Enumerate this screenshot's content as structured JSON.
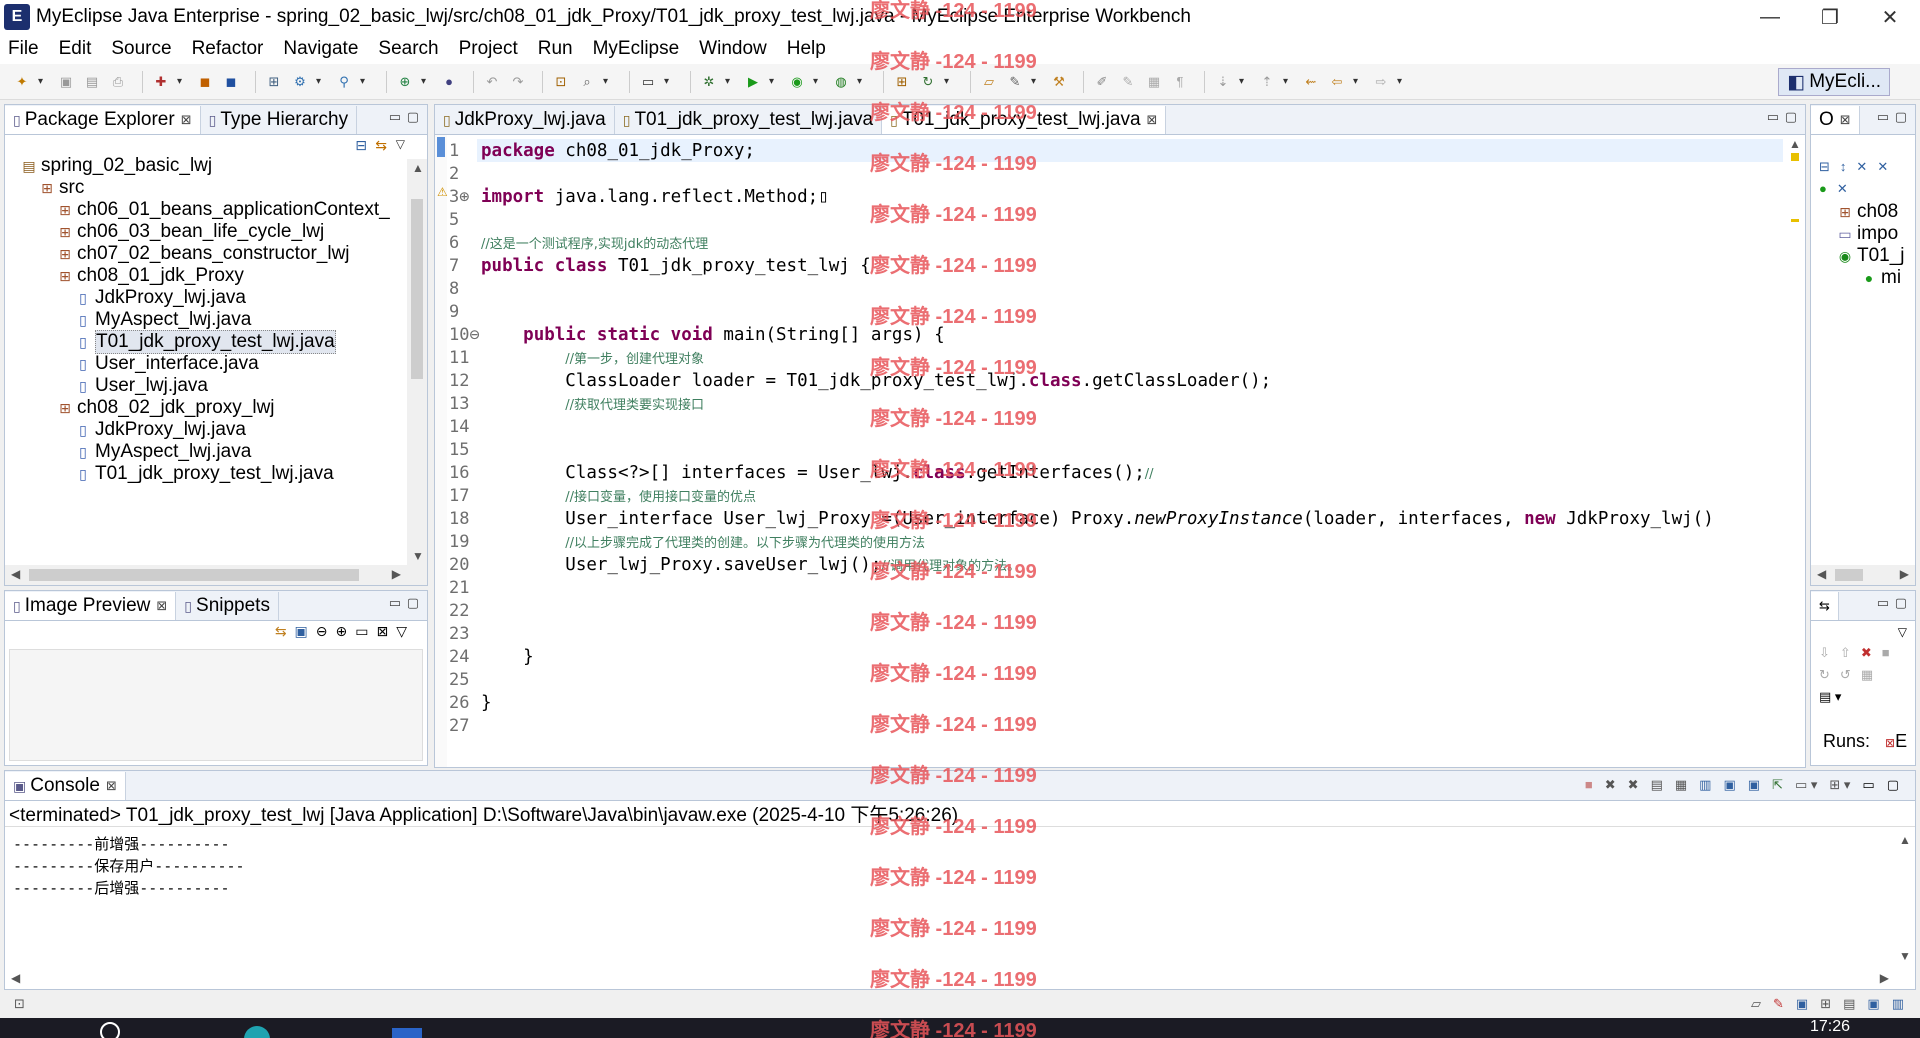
{
  "window": {
    "app_icon": "eclipse-icon",
    "title": "MyEclipse Java Enterprise - spring_02_basic_lwj/src/ch08_01_jdk_Proxy/T01_jdk_proxy_test_lwj.java - MyEclipse Enterprise Workbench",
    "minimize": "—",
    "maximize": "❐",
    "close": "✕"
  },
  "menu": [
    "File",
    "Edit",
    "Source",
    "Refactor",
    "Navigate",
    "Search",
    "Project",
    "Run",
    "MyEclipse",
    "Window",
    "Help"
  ],
  "toolbar": {
    "perspective_label": "MyEcli...",
    "perspective_icon": "myeclipse-perspective-icon",
    "open_perspective_icon": "open-perspective-icon"
  },
  "package_explorer": {
    "tabs": [
      {
        "label": "Package Explorer",
        "close": "⊠",
        "icon": "package-explorer-icon"
      },
      {
        "label": "Type Hierarchy",
        "icon": "type-hierarchy-icon"
      }
    ],
    "tree": [
      {
        "label": "spring_02_basic_lwj",
        "indent": 0,
        "kind": "project"
      },
      {
        "label": "src",
        "indent": 1,
        "kind": "folder"
      },
      {
        "label": "ch06_01_beans_applicationContext_",
        "indent": 2,
        "kind": "package"
      },
      {
        "label": "ch06_03_bean_life_cycle_lwj",
        "indent": 2,
        "kind": "package"
      },
      {
        "label": "ch07_02_beans_constructor_lwj",
        "indent": 2,
        "kind": "package"
      },
      {
        "label": "ch08_01_jdk_Proxy",
        "indent": 2,
        "kind": "package"
      },
      {
        "label": "JdkProxy_lwj.java",
        "indent": 3,
        "kind": "java"
      },
      {
        "label": "MyAspect_lwj.java",
        "indent": 3,
        "kind": "java"
      },
      {
        "label": "T01_jdk_proxy_test_lwj.java",
        "indent": 3,
        "kind": "java",
        "selected": true
      },
      {
        "label": "User_interface.java",
        "indent": 3,
        "kind": "java"
      },
      {
        "label": "User_lwj.java",
        "indent": 3,
        "kind": "java"
      },
      {
        "label": "ch08_02_jdk_proxy_lwj",
        "indent": 2,
        "kind": "package"
      },
      {
        "label": "JdkProxy_lwj.java",
        "indent": 3,
        "kind": "java"
      },
      {
        "label": "MyAspect_lwj.java",
        "indent": 3,
        "kind": "java"
      },
      {
        "label": "T01_jdk_proxy_test_lwj.java",
        "indent": 3,
        "kind": "java"
      }
    ]
  },
  "image_preview": {
    "tabs": [
      {
        "label": "Image Preview",
        "close": "⊠",
        "icon": "image-preview-icon"
      },
      {
        "label": "Snippets",
        "icon": "snippets-icon"
      }
    ]
  },
  "editor": {
    "tabs": [
      {
        "label": "JdkProxy_lwj.java",
        "icon": "java-file-icon"
      },
      {
        "label": "T01_jdk_proxy_test_lwj.java",
        "icon": "java-file-icon"
      },
      {
        "label": "T01_jdk_proxy_test_lwj.java",
        "close": "⊠",
        "active": true,
        "icon": "java-file-icon"
      }
    ],
    "lines": [
      {
        "n": "1",
        "html": "<span class=\"kw\">package</span> ch08_01_jdk_Proxy;"
      },
      {
        "n": "2",
        "html": ""
      },
      {
        "n": "3⊕",
        "html": "<span class=\"kw\">import</span> java.lang.reflect.Method;▯"
      },
      {
        "n": "5",
        "html": ""
      },
      {
        "n": "6",
        "html": "<span class=\"cm\">//这是一个测试程序,实现jdk的动态代理</span>"
      },
      {
        "n": "7",
        "html": "<span class=\"kw\">public class</span> T01_jdk_proxy_test_lwj {"
      },
      {
        "n": "8",
        "html": ""
      },
      {
        "n": "9",
        "html": ""
      },
      {
        "n": "10⊖",
        "html": "    <span class=\"kw\">public static void</span> main(String[] args) {"
      },
      {
        "n": "11",
        "html": "        <span class=\"cm\">//第一步，创建代理对象</span>"
      },
      {
        "n": "12",
        "html": "        ClassLoader loader = T01_jdk_proxy_test_lwj.<span class=\"kw\">class</span>.getClassLoader();"
      },
      {
        "n": "13",
        "html": "        <span class=\"cm\">//获取代理类要实现接口</span>"
      },
      {
        "n": "14",
        "html": ""
      },
      {
        "n": "15",
        "html": ""
      },
      {
        "n": "16",
        "html": "        Class&lt;?&gt;[] interfaces = User_lwj.<span class=\"kw\">class</span>.getInterfaces();<span class=\"cm\">//</span>"
      },
      {
        "n": "17",
        "html": "        <span class=\"cm\">//接口变量，使用接口变量的优点</span>"
      },
      {
        "n": "18",
        "html": "        User_interface User_lwj_Proxy =(User_interface) Proxy.<span class=\"it\">newProxyInstance</span>(loader, interfaces, <span class=\"kw\">new</span> JdkProxy_lwj()"
      },
      {
        "n": "19",
        "html": "        <span class=\"cm\">//以上步骤完成了代理类的创建。以下步骤为代理类的使用方法</span>"
      },
      {
        "n": "20",
        "html": "        User_lwj_Proxy.saveUser_lwj();<span class=\"cm\">//调用代理对象的方法。</span>"
      },
      {
        "n": "21",
        "html": ""
      },
      {
        "n": "22",
        "html": ""
      },
      {
        "n": "23",
        "html": ""
      },
      {
        "n": "24",
        "html": "    }"
      },
      {
        "n": "25",
        "html": ""
      },
      {
        "n": "26",
        "html": "}"
      },
      {
        "n": "27",
        "html": ""
      }
    ]
  },
  "outline": {
    "tab_label": "O",
    "close": "⊠",
    "items": [
      {
        "label": "ch08",
        "icon": "package-icon"
      },
      {
        "label": "impo",
        "icon": "imports-icon"
      },
      {
        "label": "T01_j",
        "icon": "class-icon"
      },
      {
        "label": "mi",
        "icon": "method-icon"
      }
    ]
  },
  "junit": {
    "runs_label": "Runs:",
    "errors_label": "E"
  },
  "console": {
    "tab_label": "Console",
    "close": "⊠",
    "status": "<terminated> T01_jdk_proxy_test_lwj [Java Application] D:\\Software\\Java\\bin\\javaw.exe (2025-4-10 下午5:26:26)",
    "output": [
      "---------前增强----------",
      "---------保存用户----------",
      "---------后增强----------"
    ]
  },
  "watermark": {
    "text": "廖文静 -124 - 1199",
    "color": "#e8555a"
  },
  "taskbar": {
    "time": "17:26"
  }
}
